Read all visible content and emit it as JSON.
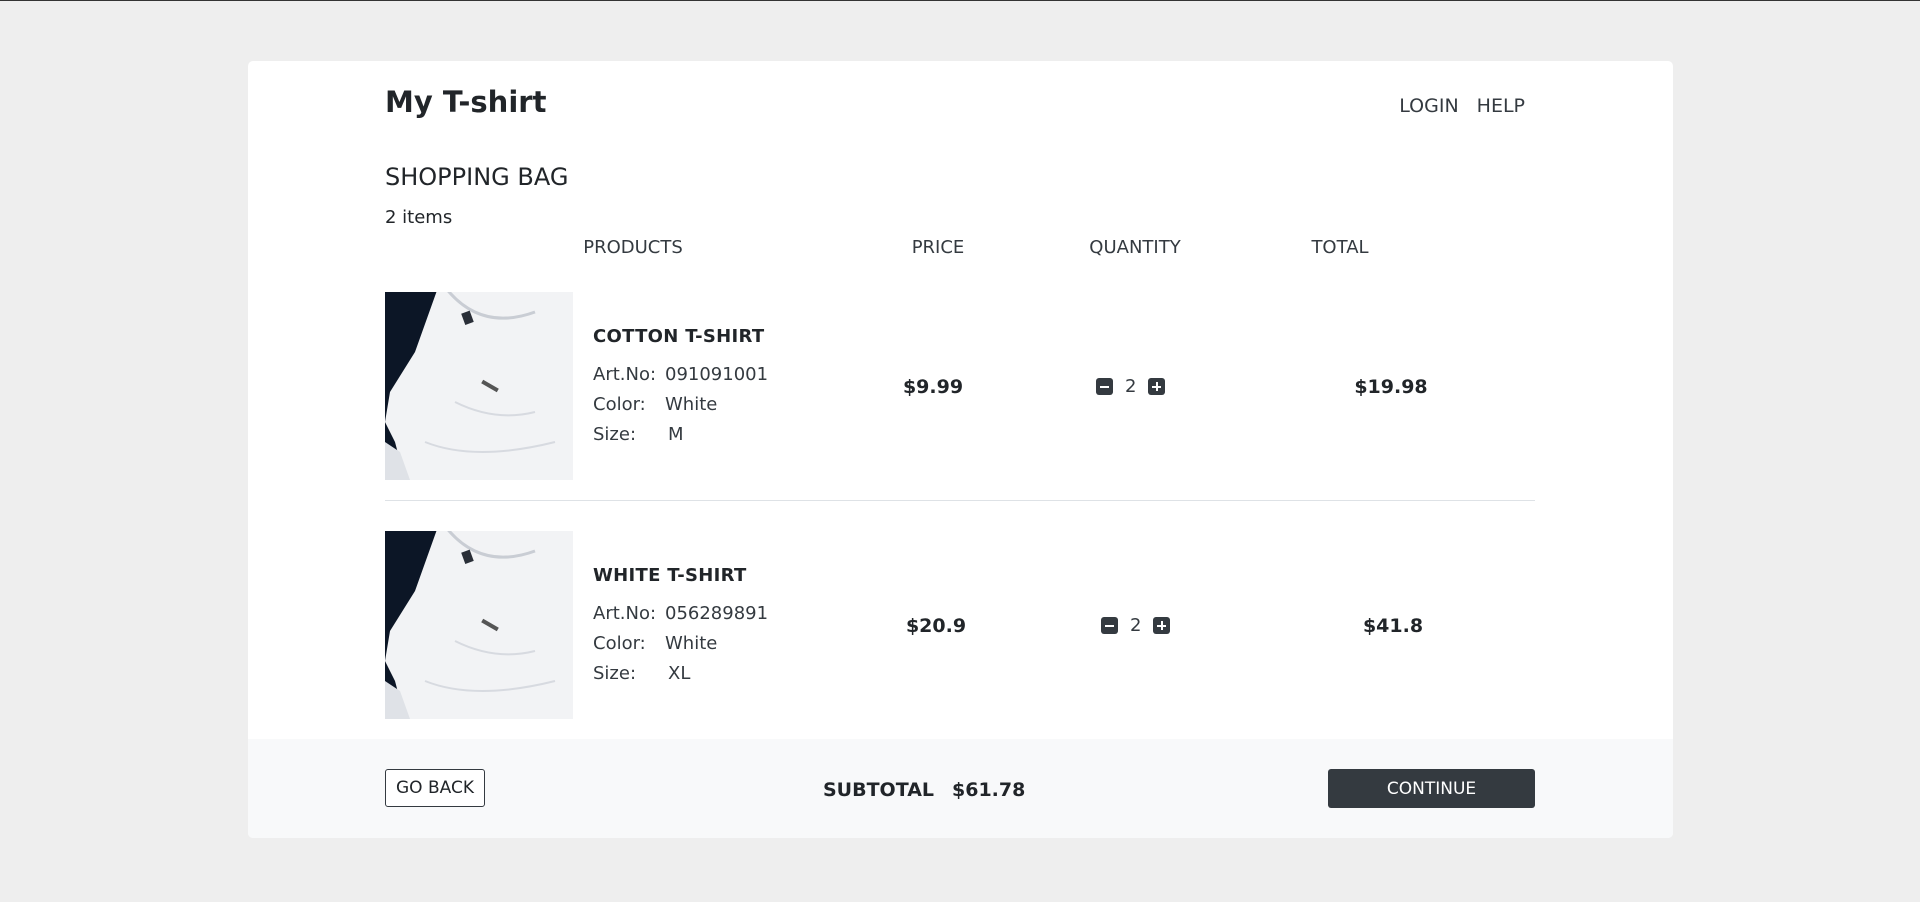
{
  "header": {
    "brand": "My T-shirt",
    "nav": [
      "LOGIN",
      "HELP"
    ]
  },
  "bag": {
    "title": "SHOPPING BAG",
    "count": "2 items",
    "columns": [
      "PRODUCTS",
      "PRICE",
      "QUANTITY",
      "TOTAL"
    ]
  },
  "items": [
    {
      "name": "COTTON T-SHIRT",
      "artno_label": "Art.No:",
      "artno": "091091001",
      "color_label": "Color:",
      "color": "White",
      "size_label": "Size:",
      "size": "M",
      "price": "$9.99",
      "quantity": "2",
      "total": "$19.98"
    },
    {
      "name": "WHITE T-SHIRT",
      "artno_label": "Art.No:",
      "artno": "056289891",
      "color_label": "Color:",
      "color": "White",
      "size_label": "Size:",
      "size": "XL",
      "price": "$20.9",
      "quantity": "2",
      "total": "$41.8"
    }
  ],
  "footer": {
    "go_back": "GO BACK",
    "subtotal_label": "SUBTOTAL",
    "subtotal_value": "$61.78",
    "continue": "CONTINUE"
  },
  "icons": {
    "remove": "×",
    "minus": "minus-square-icon",
    "plus": "plus-square-icon"
  },
  "colors": {
    "background": "#eeeeee",
    "card": "#ffffff",
    "footer": "#f8f9fa",
    "button_dark": "#343a40"
  }
}
